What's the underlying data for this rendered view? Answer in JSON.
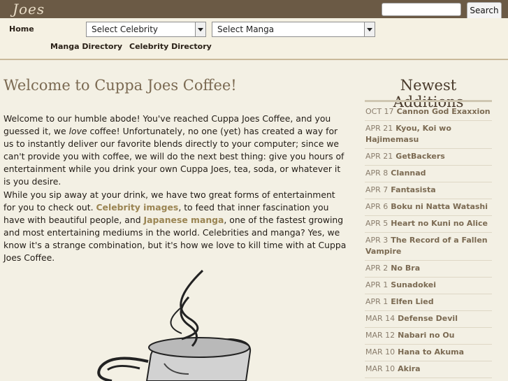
{
  "site": {
    "logo": "Joes"
  },
  "search": {
    "placeholder": "",
    "button_label": "Search"
  },
  "nav": {
    "home": "Home",
    "celebrity_select": "Select Celebrity",
    "manga_select": "Select Manga",
    "manga_directory": "Manga Directory",
    "celebrity_directory": "Celebrity Directory"
  },
  "main": {
    "title": "Welcome to Cuppa Joes Coffee!",
    "p1_a": "Welcome to our humble abode! You've reached Cuppa Joes Coffee, and you guessed it, we ",
    "p1_em": "love",
    "p1_b": " coffee! Unfortunately, no one (yet) has created a way for us to instantly deliver our favorite blends directly to your computer; since we can't provide you with coffee, we will do the next best thing: give you hours of entertainment while you drink your own Cuppa Joes, tea, soda, or whatever it is you desire.",
    "p2_a": "While you sip away at your drink, we have two great forms of entertainment for you to check out. ",
    "p2_link1": "Celebrity images",
    "p2_b": ", to feed that inner fascination you have with beautiful people, and ",
    "p2_link2": "Japanese manga",
    "p2_c": ", one of the fastest growing and most entertaining mediums in the world. Celebrities and manga? Yes, we know it's a strange combination, but it's how we love to kill time with at Cuppa Joes Coffee."
  },
  "sidebar": {
    "title": "Newest Additions",
    "items": [
      {
        "date": "OCT 17",
        "title": "Cannon God Exaxxion"
      },
      {
        "date": "APR 21",
        "title": "Kyou, Koi wo Hajimemasu"
      },
      {
        "date": "APR 21",
        "title": "GetBackers"
      },
      {
        "date": "APR 8",
        "title": "Clannad"
      },
      {
        "date": "APR 7",
        "title": "Fantasista"
      },
      {
        "date": "APR 6",
        "title": "Boku ni Natta Watashi"
      },
      {
        "date": "APR 5",
        "title": "Heart no Kuni no Alice"
      },
      {
        "date": "APR 3",
        "title": "The Record of a Fallen Vampire"
      },
      {
        "date": "APR 2",
        "title": "No Bra"
      },
      {
        "date": "APR 1",
        "title": "Sunadokei"
      },
      {
        "date": "APR 1",
        "title": "Elfen Lied"
      },
      {
        "date": "MAR 14",
        "title": "Defense Devil"
      },
      {
        "date": "MAR 12",
        "title": "Nabari no Ou"
      },
      {
        "date": "MAR 10",
        "title": "Hana to Akuma"
      },
      {
        "date": "MAR 10",
        "title": "Akira"
      }
    ]
  }
}
